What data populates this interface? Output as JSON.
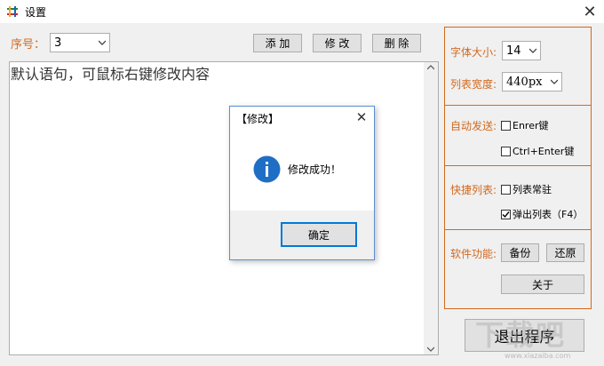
{
  "window": {
    "title": "设置",
    "icon": "app-grid-icon",
    "close_icon": "close-icon"
  },
  "toolbar": {
    "seq_label": "序号：",
    "seq_value": "3",
    "add_label": "添 加",
    "edit_label": "修 改",
    "delete_label": "删 除"
  },
  "editor": {
    "text": "默认语句，可鼠标右键修改内容"
  },
  "settings": {
    "font_size_label": "字体大小:",
    "font_size_value": "14",
    "list_width_label": "列表宽度:",
    "list_width_value": "440px",
    "auto_send_label": "自动发送:",
    "enter_key_label": "Enrer键",
    "ctrl_enter_label": "Ctrl+Enter键",
    "quick_list_label": "快捷列表:",
    "list_pinned_label": "列表常驻",
    "popup_list_label": "弹出列表（F4）",
    "software_label": "软件功能:",
    "backup_label": "备份",
    "restore_label": "还原",
    "about_label": "关于",
    "enter_key_checked": false,
    "ctrl_enter_checked": false,
    "list_pinned_checked": false,
    "popup_list_checked": true
  },
  "exit_label": "退出程序",
  "dialog": {
    "title": "【修改】",
    "message": "修改成功！",
    "ok_label": "确定",
    "icon": "info-icon",
    "accent": "#1e6fc4"
  },
  "watermark": {
    "text": "下载吧",
    "sub": "www.xiazaiba.com"
  },
  "colors": {
    "orange": "#d2691e",
    "background": "#f0f0f0",
    "dialog_border": "#5b8fd1"
  }
}
